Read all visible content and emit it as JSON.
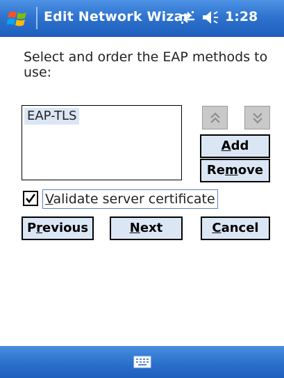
{
  "titlebar": {
    "title": "Edit Network Wizar",
    "time": "1:28",
    "icons": [
      "windows-start-icon",
      "connectivity-icon",
      "volume-icon"
    ]
  },
  "instruction": "Select and order the EAP methods to use:",
  "eap_list": {
    "items": [
      "EAP-TLS"
    ],
    "selected": "EAP-TLS"
  },
  "arrows": {
    "up_icon": "double-chevron-up-icon",
    "down_icon": "double-chevron-down-icon"
  },
  "buttons": {
    "add": {
      "pre": "",
      "ul": "A",
      "post": "dd"
    },
    "remove": {
      "pre": "Re",
      "ul": "m",
      "post": "ove"
    },
    "previous": {
      "pre": "P",
      "ul": "r",
      "post": "evious"
    },
    "next": {
      "pre": "",
      "ul": "N",
      "post": "ext"
    },
    "cancel": {
      "pre": "",
      "ul": "C",
      "post": "ancel"
    }
  },
  "validate_checkbox": {
    "checked": true,
    "label_ul": "V",
    "label_rest": "alidate server certificate"
  },
  "bottombar": {
    "icon": "keyboard-icon"
  },
  "colors": {
    "title_bar": "#2f74cf",
    "button_fill": "#dbe6f5",
    "selection": "#dbe6f5"
  }
}
